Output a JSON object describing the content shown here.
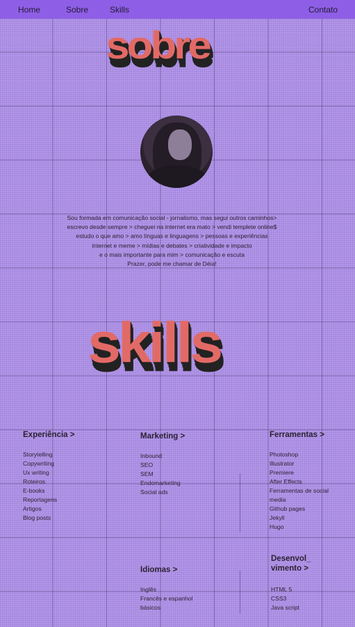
{
  "nav": {
    "home": "Home",
    "about": "Sobre",
    "skills": "Skills",
    "contact": "Contato"
  },
  "about": {
    "title": "sobre",
    "bio": [
      "Sou formada em comunicação social - jornalismo, mas segui outros caminhos>",
      "escrevo desde sempre > cheguei na internet era mato > vendi templete online$",
      "estudo o que amo > amo línguas e linguagens > pessoas e experiências",
      "internet e meme > mídias e debates > criatividade e impacto",
      "e o mais importante para mim > comunicação e escuta",
      "Prazer, pode me chamar de Déia!"
    ]
  },
  "skills": {
    "title": "skills",
    "experience": {
      "title": "Experiência >",
      "items": [
        "Storytelling",
        "Copywriting",
        "Ux writing",
        "Roteiros",
        "E-books",
        "Reportagens",
        "Artigos",
        "Blog posts"
      ]
    },
    "marketing": {
      "title": "Marketing >",
      "items": [
        "Inbound",
        "SEO",
        "SEM",
        "Endomarketing",
        "Social ads"
      ]
    },
    "tools": {
      "title": "Ferramentas >",
      "items": [
        "Photoshop",
        "Illustrator",
        "Premiere",
        "After Effects",
        "Ferramentas de social",
        "media",
        "Github pages",
        "Jekyll",
        "Hugo"
      ]
    },
    "languages": {
      "title": "Idiomas >",
      "items": [
        "Inglês",
        "Francês e espanhol",
        "básicos"
      ]
    },
    "dev": {
      "title_line1": "Desenvol_",
      "title_line2": "vimento >",
      "items": [
        "HTML 5",
        "CSS3",
        "Java script"
      ]
    }
  }
}
